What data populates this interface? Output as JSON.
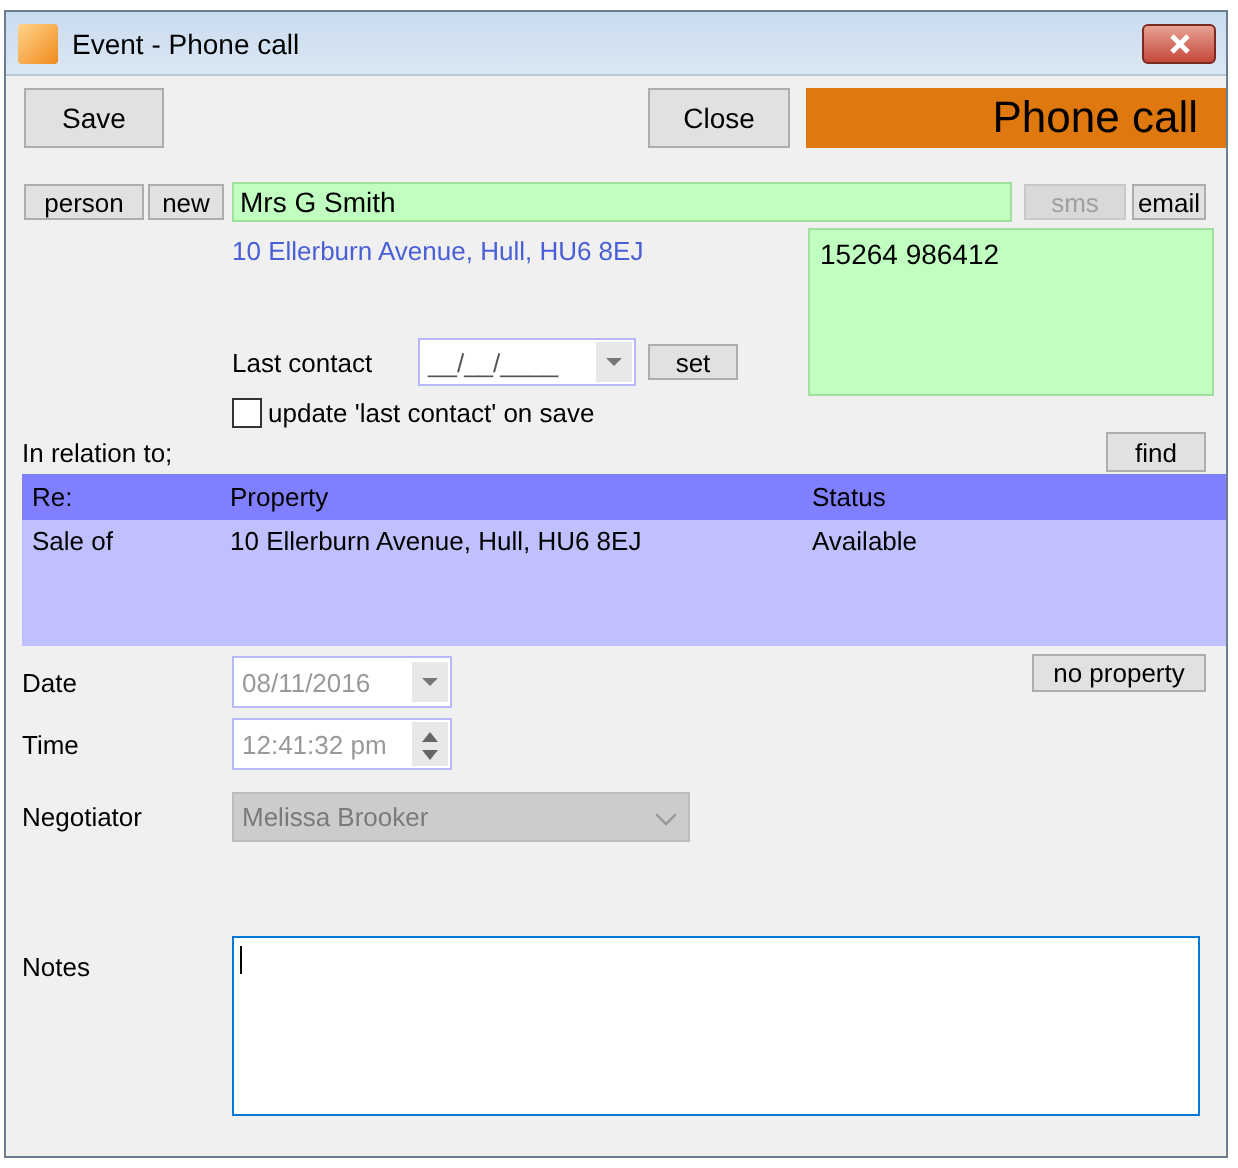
{
  "window": {
    "title": "Event - Phone call"
  },
  "toolbar": {
    "save_button": "Save",
    "close_button": "Close",
    "banner": "Phone call"
  },
  "contact": {
    "person_button": "person",
    "new_button": "new",
    "name": "Mrs G Smith",
    "sms_button": {
      "label": "sms",
      "disabled": true
    },
    "email_button": {
      "label": "email",
      "disabled": false
    },
    "address": "10 Ellerburn Avenue, Hull, HU6 8EJ",
    "phone": "15264 986412",
    "last_contact_label": "Last contact",
    "last_contact_value": "__/__/____",
    "set_button": "set",
    "update_checkbox": {
      "label": "update 'last contact' on save",
      "checked": false
    }
  },
  "relation": {
    "label": "In relation to;",
    "find_button": "find",
    "columns": [
      "Re:",
      "Property",
      "Status"
    ],
    "rows": [
      [
        "Sale of",
        "10 Ellerburn Avenue, Hull, HU6 8EJ",
        "Available"
      ]
    ],
    "no_property_button": "no property"
  },
  "fields": [
    {
      "kind": "date",
      "label": "Date",
      "value": "08/11/2016",
      "disabled": true
    },
    {
      "kind": "time",
      "label": "Time",
      "value": "12:41:32 pm",
      "disabled": true
    },
    {
      "kind": "combo",
      "label": "Negotiator",
      "value": "Melissa Brooker",
      "disabled": true
    }
  ],
  "notes": {
    "label": "Notes"
  }
}
